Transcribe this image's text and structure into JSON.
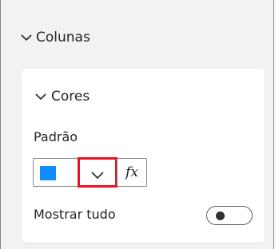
{
  "section": {
    "title": "Colunas",
    "icon": "chevron-down-icon"
  },
  "card": {
    "title": "Cores",
    "icon": "chevron-down-icon",
    "field_label": "Padrão",
    "color_value": "#118DFF",
    "dropdown_icon": "chevron-down-icon",
    "fx_label": "fx",
    "toggle_label": "Mostrar tudo",
    "toggle_state": "off"
  },
  "colors": {
    "panel_bg": "#f3f2f1",
    "card_bg": "#ffffff",
    "highlight": "#e81123",
    "swatch": "#118DFF"
  }
}
